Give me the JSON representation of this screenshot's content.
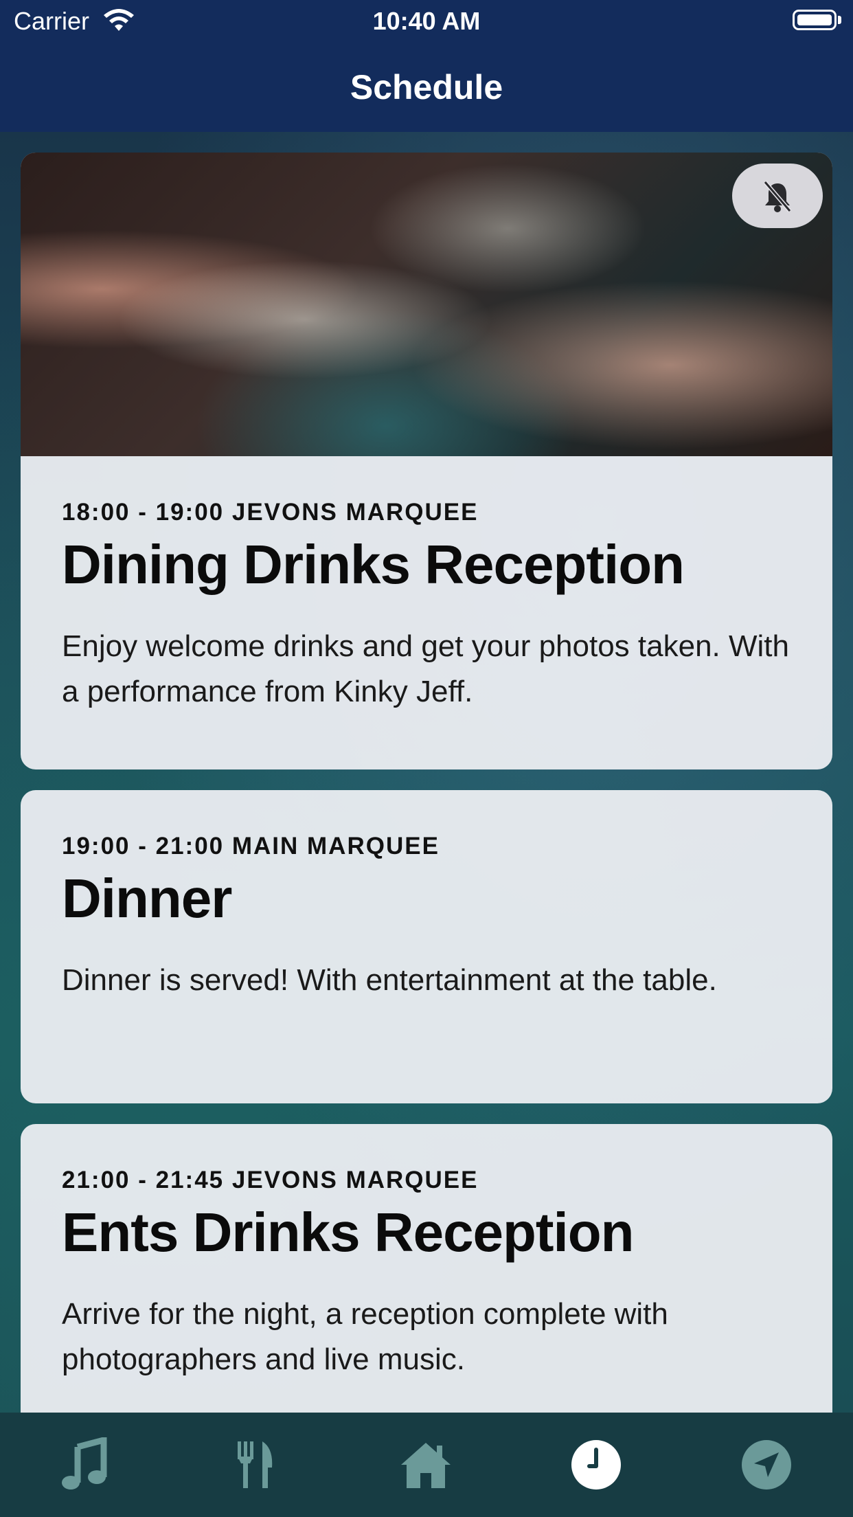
{
  "status_bar": {
    "carrier": "Carrier",
    "time": "10:40 AM"
  },
  "nav": {
    "title": "Schedule"
  },
  "events": [
    {
      "meta": "18:00 - 19:00 JEVONS MARQUEE",
      "title": "Dining Drinks Reception",
      "description": "Enjoy welcome drinks and get your photos taken. With a performance from Kinky Jeff.",
      "has_image": true,
      "bell_icon": "bell-slash-icon"
    },
    {
      "meta": "19:00 - 21:00 MAIN MARQUEE",
      "title": "Dinner",
      "description": "Dinner is served! With entertainment at the table."
    },
    {
      "meta": "21:00 - 21:45 JEVONS MARQUEE",
      "title": "Ents Drinks Reception",
      "description": "Arrive for the night, a reception complete with photographers and live music."
    }
  ],
  "tab_bar": {
    "tabs": [
      {
        "icon": "music-icon",
        "selected": false
      },
      {
        "icon": "fork-knife-icon",
        "selected": false
      },
      {
        "icon": "home-icon",
        "selected": false
      },
      {
        "icon": "clock-icon",
        "selected": true
      },
      {
        "icon": "location-arrow-icon",
        "selected": false
      }
    ],
    "inactive_color": "#6b9a99",
    "active_color": "#ffffff"
  }
}
